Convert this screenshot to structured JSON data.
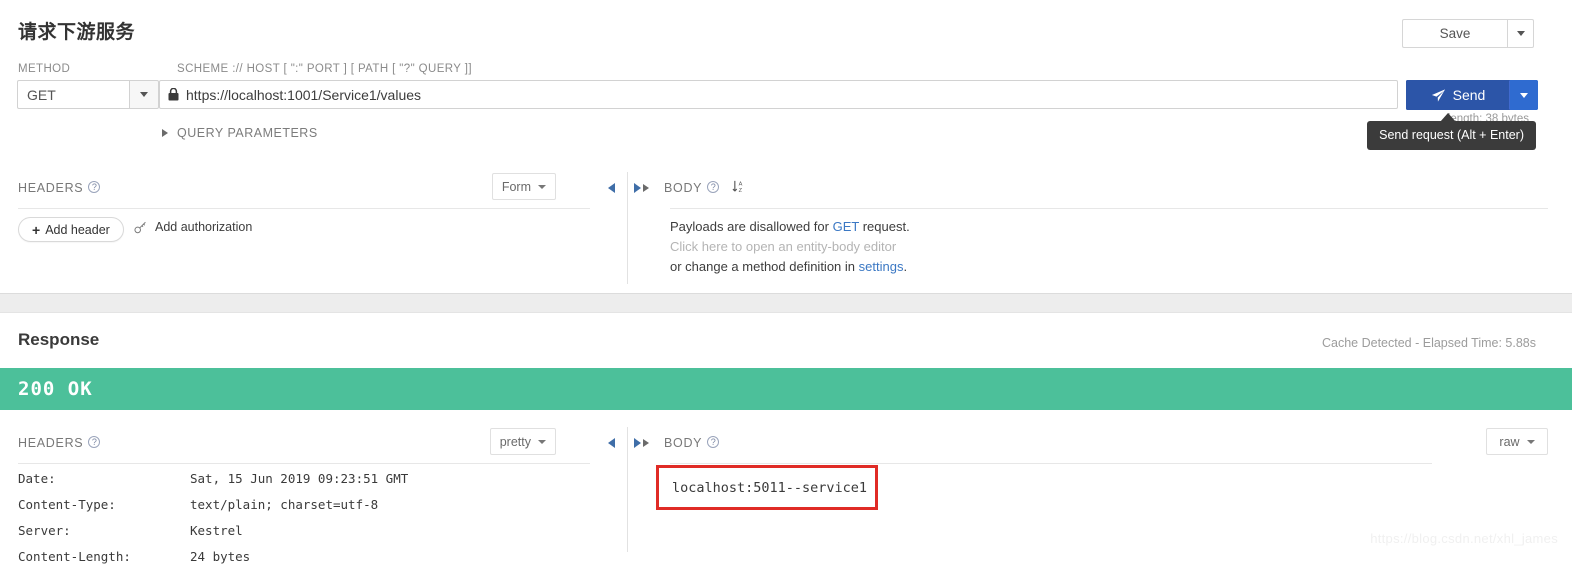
{
  "request": {
    "title": "请求下游服务",
    "save": {
      "label": "Save",
      "caret_icon": "chevron-down-icon"
    },
    "method": {
      "label": "METHOD",
      "value": "GET",
      "caret_icon": "chevron-down-icon"
    },
    "url": {
      "label": "SCHEME :// HOST [ \":\" PORT ] [ PATH [ \"?\" QUERY ]]",
      "value": "https://localhost:1001/Service1/values",
      "lock_icon": "lock-icon",
      "length_text": "length: 38 bytes"
    },
    "query_parameters": {
      "label": "QUERY PARAMETERS",
      "toggle_icon": "triangle-right-icon"
    },
    "send": {
      "label": "Send",
      "send_icon": "paper-plane-icon",
      "caret_icon": "chevron-down-icon"
    },
    "tooltip": "Send request (Alt + Enter)",
    "headers": {
      "title": "HEADERS",
      "help_icon": "question-mark-icon",
      "view_mode": "Form",
      "add_header_label": "Add header",
      "add_header_icon": "plus-icon",
      "add_authorization_label": "Add authorization",
      "add_authorization_icon": "key-icon"
    },
    "body": {
      "title": "BODY",
      "help_icon": "question-mark-icon",
      "sort_icon": "sort-alpha-icon",
      "toggle_icon": "triangle-right-icon",
      "line1_pre": "Payloads are disallowed for ",
      "line1_link": "GET",
      "line1_post": " request.",
      "line2": "Click here to open an entity-body editor",
      "line3_pre": "or change a method definition in ",
      "line3_link": "settings",
      "line3_post": "."
    },
    "collapse_left_icon": "collapse-left-icon",
    "collapse_right_icon": "collapse-right-icon"
  },
  "response": {
    "title": "Response",
    "cache_info": "Cache Detected - Elapsed Time: 5.88s",
    "status": "200 OK",
    "status_color": "#4cc09a",
    "headers": {
      "title": "HEADERS",
      "help_icon": "question-mark-icon",
      "view_mode": "pretty",
      "rows": [
        {
          "key": "Date:",
          "value": "Sat, 15 Jun 2019 09:23:51 GMT"
        },
        {
          "key": "Content-Type:",
          "value": "text/plain; charset=utf-8"
        },
        {
          "key": "Server:",
          "value": "Kestrel"
        },
        {
          "key": "Content-Length:",
          "value": "24 bytes"
        }
      ]
    },
    "body": {
      "title": "BODY",
      "help_icon": "question-mark-icon",
      "toggle_icon": "triangle-right-icon",
      "view_mode": "raw",
      "value": "localhost:5011--service1",
      "highlight_color": "#e02b26"
    },
    "collapse_left_icon": "collapse-left-icon",
    "collapse_right_icon": "collapse-right-icon"
  },
  "watermark": "https://blog.csdn.net/xhl_james"
}
